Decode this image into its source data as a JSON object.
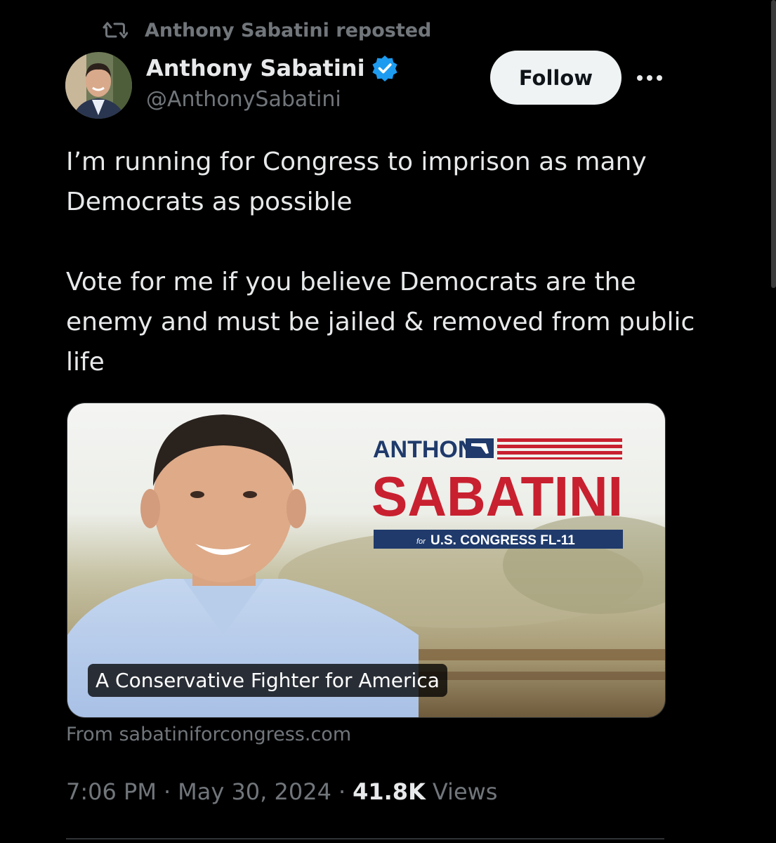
{
  "repost": {
    "icon": "repost-icon",
    "text": "Anthony Sabatini reposted"
  },
  "author": {
    "avatar_icon": "avatar-photo",
    "display_name": "Anthony Sabatini",
    "verified_icon": "verified-badge-icon",
    "verified_color": "#1d9bf0",
    "handle": "@AnthonySabatini"
  },
  "actions": {
    "follow_label": "Follow",
    "more_icon": "more-icon"
  },
  "tweet": {
    "paragraph_1": "I’m running for Congress to imprison as many Democrats as possible",
    "paragraph_2": "Vote for me if you believe Democrats are the enemy and must be jailed & removed from public life"
  },
  "link_card": {
    "title": "A Conservative Fighter for America",
    "source": "From sabatiniforcongress.com",
    "logo": {
      "first_name": "ANTHONY",
      "last_name": "SABATINI",
      "for_text": "for",
      "office": "U.S. CONGRESS FL-11",
      "red": "#c8202f",
      "navy": "#1f3a6b"
    }
  },
  "meta": {
    "time": "7:06 PM",
    "separator": "·",
    "date": "May 30, 2024",
    "views_count": "41.8K",
    "views_label": "Views"
  },
  "colors": {
    "background": "#000000",
    "primary_text": "#e7e9ea",
    "secondary_text": "#71767b",
    "follow_bg": "#eff3f4"
  }
}
